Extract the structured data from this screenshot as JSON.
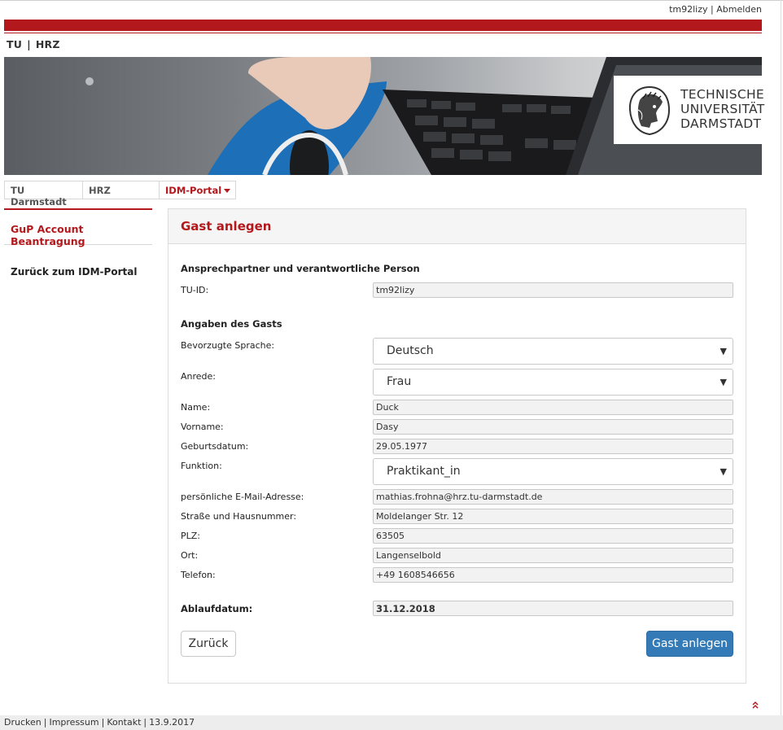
{
  "header": {
    "username": "tm92lizy",
    "separator": "|",
    "logout": "Abmelden",
    "brand_tu": "TU",
    "brand_sep": "|",
    "brand_hrz": "HRZ"
  },
  "logo": {
    "line1": "TECHNISCHE",
    "line2": "UNIVERSITÄT",
    "line3": "DARMSTADT"
  },
  "breadcrumb": {
    "items": [
      "TU Darmstadt",
      "HRZ",
      "IDM-Portal"
    ]
  },
  "sidebar": {
    "items": [
      {
        "label": "GuP Account Beantragung",
        "active": true
      },
      {
        "label": "Zurück zum IDM-Portal",
        "active": false
      }
    ]
  },
  "panel": {
    "title": "Gast anlegen",
    "section_contact": "Ansprechpartner und verantwortliche Person",
    "tuid_label": "TU-ID:",
    "tuid_value": "tm92lizy",
    "section_guest": "Angaben des Gasts",
    "fields": {
      "language": {
        "label": "Bevorzugte Sprache:",
        "value": "Deutsch"
      },
      "salutation": {
        "label": "Anrede:",
        "value": "Frau"
      },
      "name": {
        "label": "Name:",
        "value": "Duck"
      },
      "firstname": {
        "label": "Vorname:",
        "value": "Dasy"
      },
      "birthdate": {
        "label": "Geburtsdatum:",
        "value": "29.05.1977"
      },
      "function": {
        "label": "Funktion:",
        "value": "Praktikant_in"
      },
      "email": {
        "label": "persönliche E-Mail-Adresse:",
        "value": "mathias.frohna@hrz.tu-darmstadt.de"
      },
      "street": {
        "label": "Straße und Hausnummer:",
        "value": "Moldelanger Str. 12"
      },
      "zip": {
        "label": "PLZ:",
        "value": "63505"
      },
      "city": {
        "label": "Ort:",
        "value": "Langenselbold"
      },
      "phone": {
        "label": "Telefon:",
        "value": "+49 1608546656"
      },
      "expiry": {
        "label": "Ablaufdatum:",
        "value": "31.12.2018"
      }
    },
    "back_button": "Zurück",
    "submit_button": "Gast anlegen"
  },
  "footer": {
    "print": "Drucken",
    "imprint": "Impressum",
    "contact": "Kontakt",
    "date": "13.9.2017",
    "sep": "|"
  },
  "colors": {
    "accent_red": "#b3191c",
    "button_blue": "#337ab7"
  },
  "icons": {
    "select_arrow": "triangle-down-icon",
    "dropdown_caret": "caret-down-icon",
    "back_to_top": "double-chevron-up-icon"
  }
}
